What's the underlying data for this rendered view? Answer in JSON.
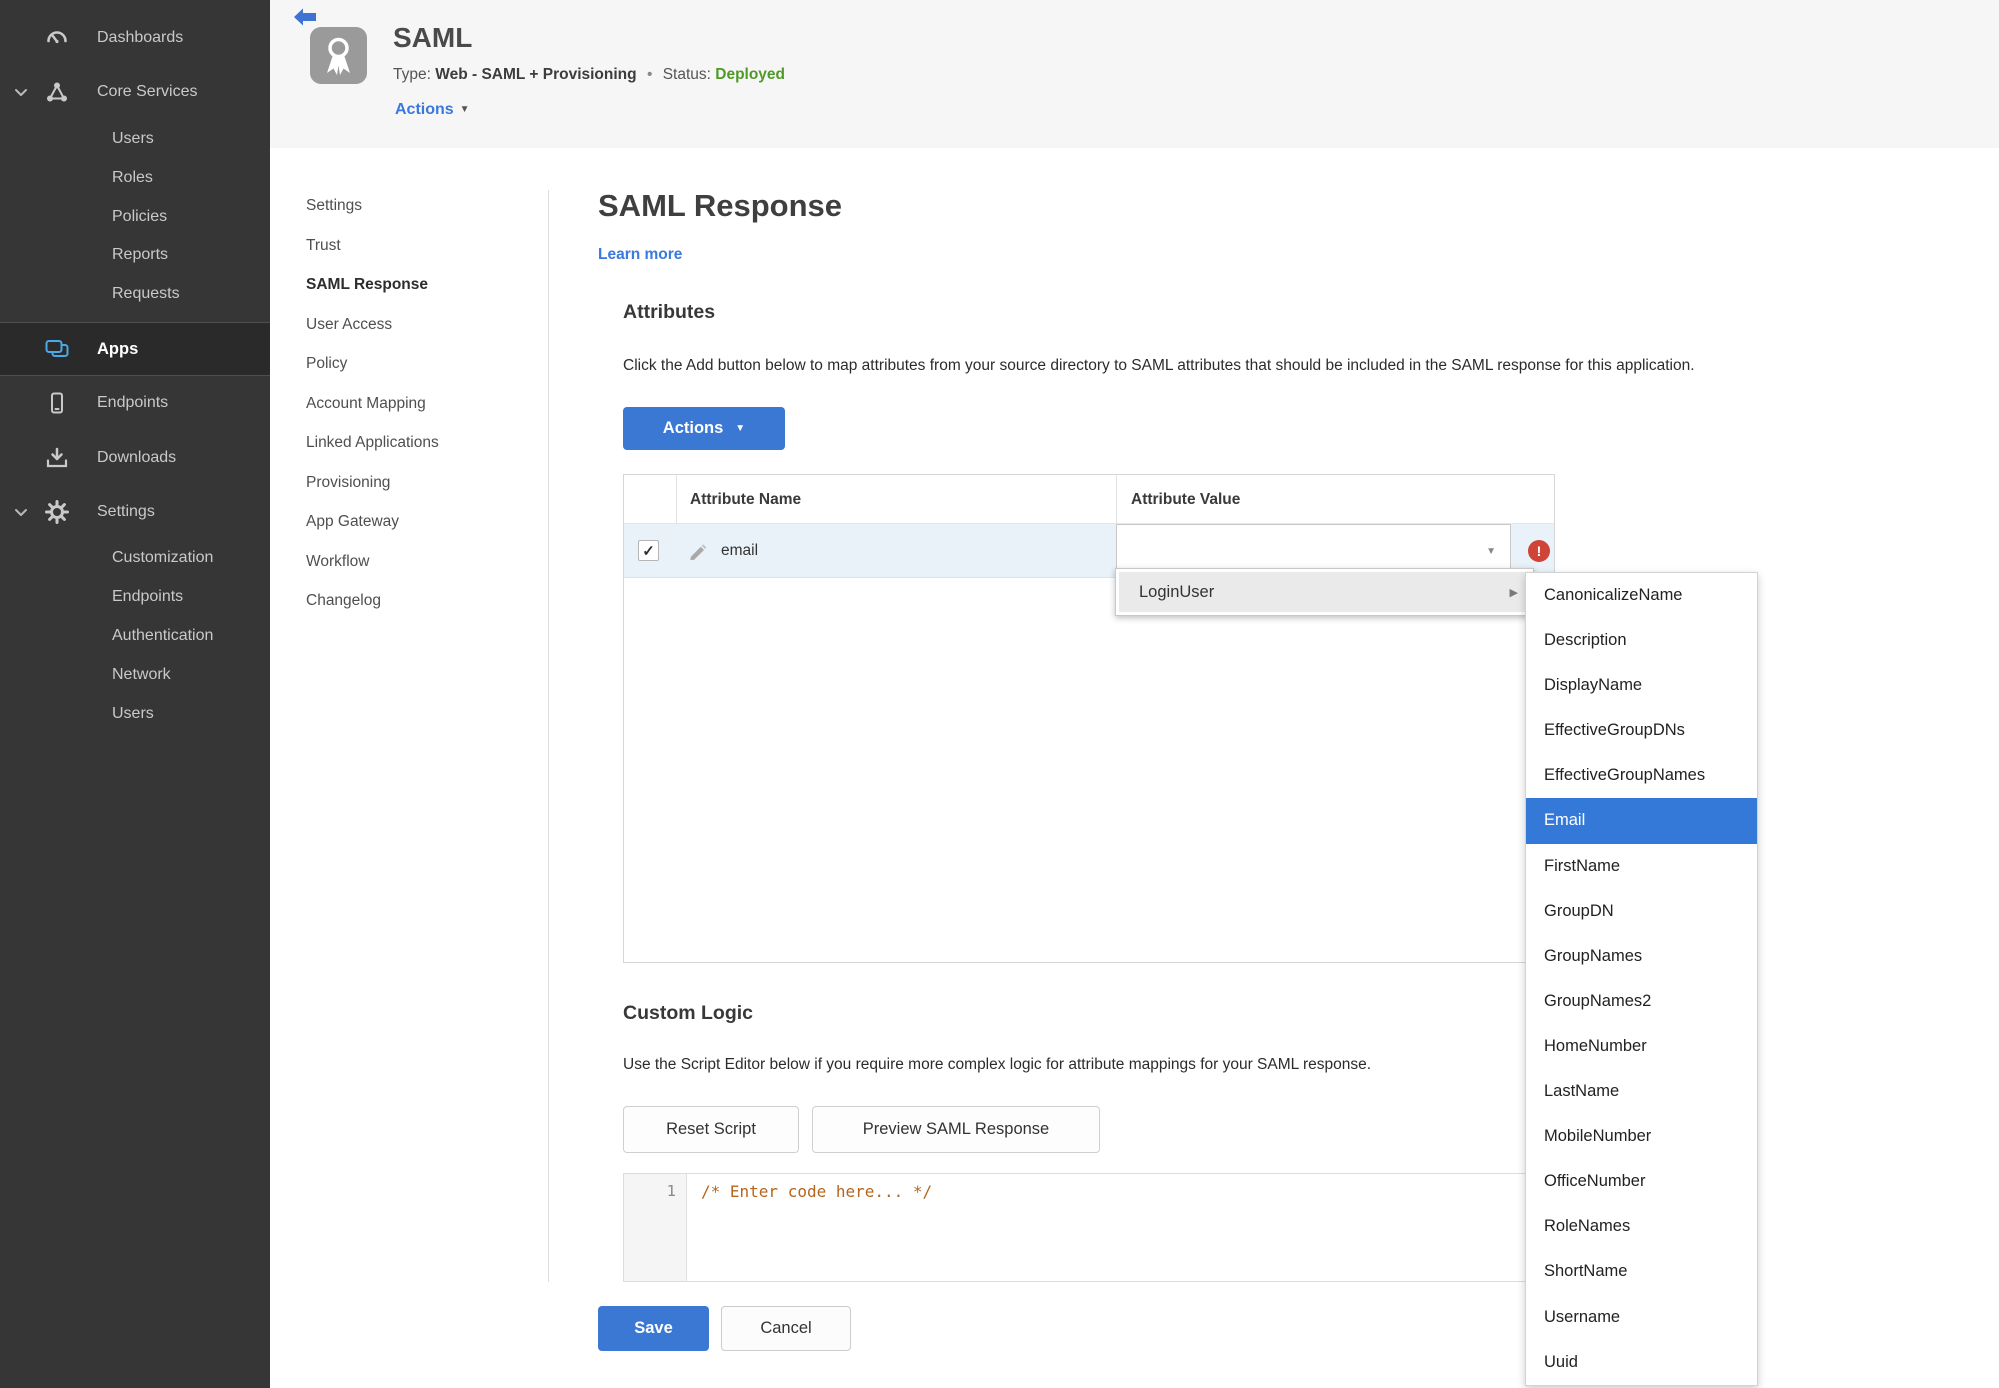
{
  "glyphs": {
    "caret_down": "▼",
    "caret_right": "▶",
    "check": "✓",
    "exclamation": "!",
    "bullet": "•"
  },
  "colors": {
    "accent_blue": "#3a78d4",
    "status_green": "#4e9a27",
    "error_red": "#cf4436",
    "highlight_blue": "#3579d8"
  },
  "sidebar": {
    "items": [
      {
        "label": "Dashboards"
      },
      {
        "label": "Core Services"
      },
      {
        "label": "Users"
      },
      {
        "label": "Roles"
      },
      {
        "label": "Policies"
      },
      {
        "label": "Reports"
      },
      {
        "label": "Requests"
      },
      {
        "label": "Apps"
      },
      {
        "label": "Endpoints"
      },
      {
        "label": "Downloads"
      },
      {
        "label": "Settings"
      },
      {
        "label": "Customization"
      },
      {
        "label": "Endpoints"
      },
      {
        "label": "Authentication"
      },
      {
        "label": "Network"
      },
      {
        "label": "Users"
      }
    ]
  },
  "header": {
    "title": "SAML",
    "type_label": "Type:",
    "type_value": "Web - SAML + Provisioning",
    "status_label": "Status:",
    "status_value": "Deployed",
    "actions_label": "Actions"
  },
  "subnav": {
    "items": [
      {
        "label": "Settings"
      },
      {
        "label": "Trust"
      },
      {
        "label": "SAML Response"
      },
      {
        "label": "User Access"
      },
      {
        "label": "Policy"
      },
      {
        "label": "Account Mapping"
      },
      {
        "label": "Linked Applications"
      },
      {
        "label": "Provisioning"
      },
      {
        "label": "App Gateway"
      },
      {
        "label": "Workflow"
      },
      {
        "label": "Changelog"
      }
    ],
    "active": "SAML Response"
  },
  "main": {
    "title": "SAML Response",
    "learn_more": "Learn more",
    "attributes": {
      "heading": "Attributes",
      "description": "Click the Add button below to map attributes from your source directory to SAML attributes that should be included in the SAML response for this application.",
      "actions_button": "Actions",
      "table": {
        "columns": [
          "Attribute Name",
          "Attribute Value"
        ],
        "rows": [
          {
            "name": "email",
            "value": "",
            "checked": true,
            "error": true
          }
        ]
      }
    },
    "dropdown": {
      "menu_item": "LoginUser",
      "selected": "Email",
      "submenu": [
        "CanonicalizeName",
        "Description",
        "DisplayName",
        "EffectiveGroupDNs",
        "EffectiveGroupNames",
        "Email",
        "FirstName",
        "GroupDN",
        "GroupNames",
        "GroupNames2",
        "HomeNumber",
        "LastName",
        "MobileNumber",
        "OfficeNumber",
        "RoleNames",
        "ShortName",
        "Username",
        "Uuid"
      ]
    },
    "custom_logic": {
      "heading": "Custom Logic",
      "description": "Use the Script Editor below if you require more complex logic for attribute mappings for your SAML response.",
      "reset_button": "Reset Script",
      "preview_button": "Preview SAML Response",
      "editor": {
        "line_number": "1",
        "code": "/* Enter code here... */"
      }
    },
    "footer": {
      "save": "Save",
      "cancel": "Cancel"
    }
  }
}
